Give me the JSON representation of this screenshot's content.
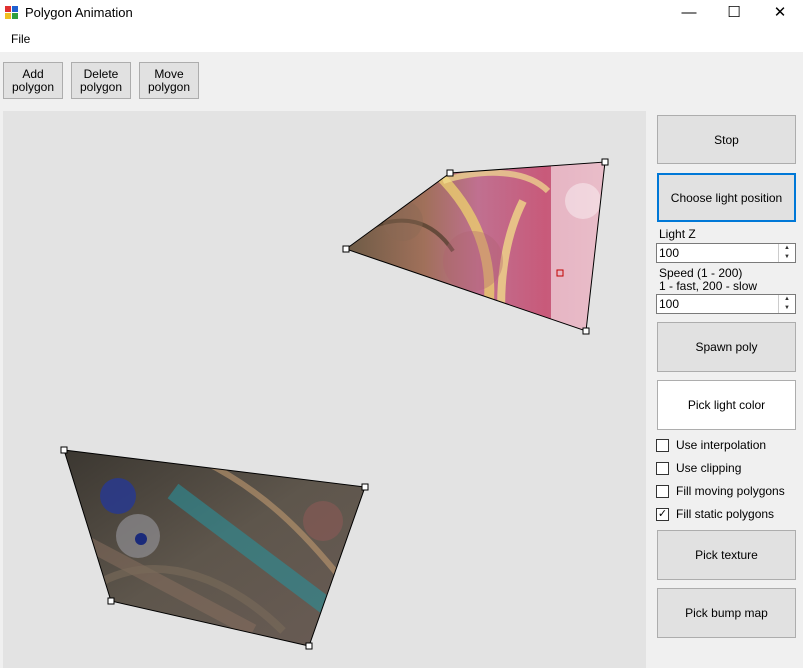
{
  "window": {
    "title": "Polygon Animation",
    "controls": {
      "minimize": "—",
      "maximize": "☐",
      "close": "✕"
    }
  },
  "menu": {
    "file": "File"
  },
  "toolbar": {
    "add": "Add\npolygon",
    "delete": "Delete\npolygon",
    "move": "Move\npolygon"
  },
  "panel": {
    "stop": "Stop",
    "choose_light": "Choose light position",
    "light_z_label": "Light Z",
    "light_z_value": "100",
    "speed_label": "Speed (1 - 200)",
    "speed_hint": "1 - fast, 200 - slow",
    "speed_value": "100",
    "spawn": "Spawn poly",
    "pick_light_color": "Pick light color",
    "checkboxes": [
      {
        "label": "Use interpolation",
        "checked": false
      },
      {
        "label": "Use clipping",
        "checked": false
      },
      {
        "label": "Fill moving polygons",
        "checked": false
      },
      {
        "label": "Fill static polygons",
        "checked": true
      }
    ],
    "pick_texture": "Pick texture",
    "pick_bump": "Pick bump map"
  },
  "colors": {
    "accent": "#0078d7",
    "canvas_bg": "#e3e3e3",
    "light_marker": "#c00000"
  }
}
